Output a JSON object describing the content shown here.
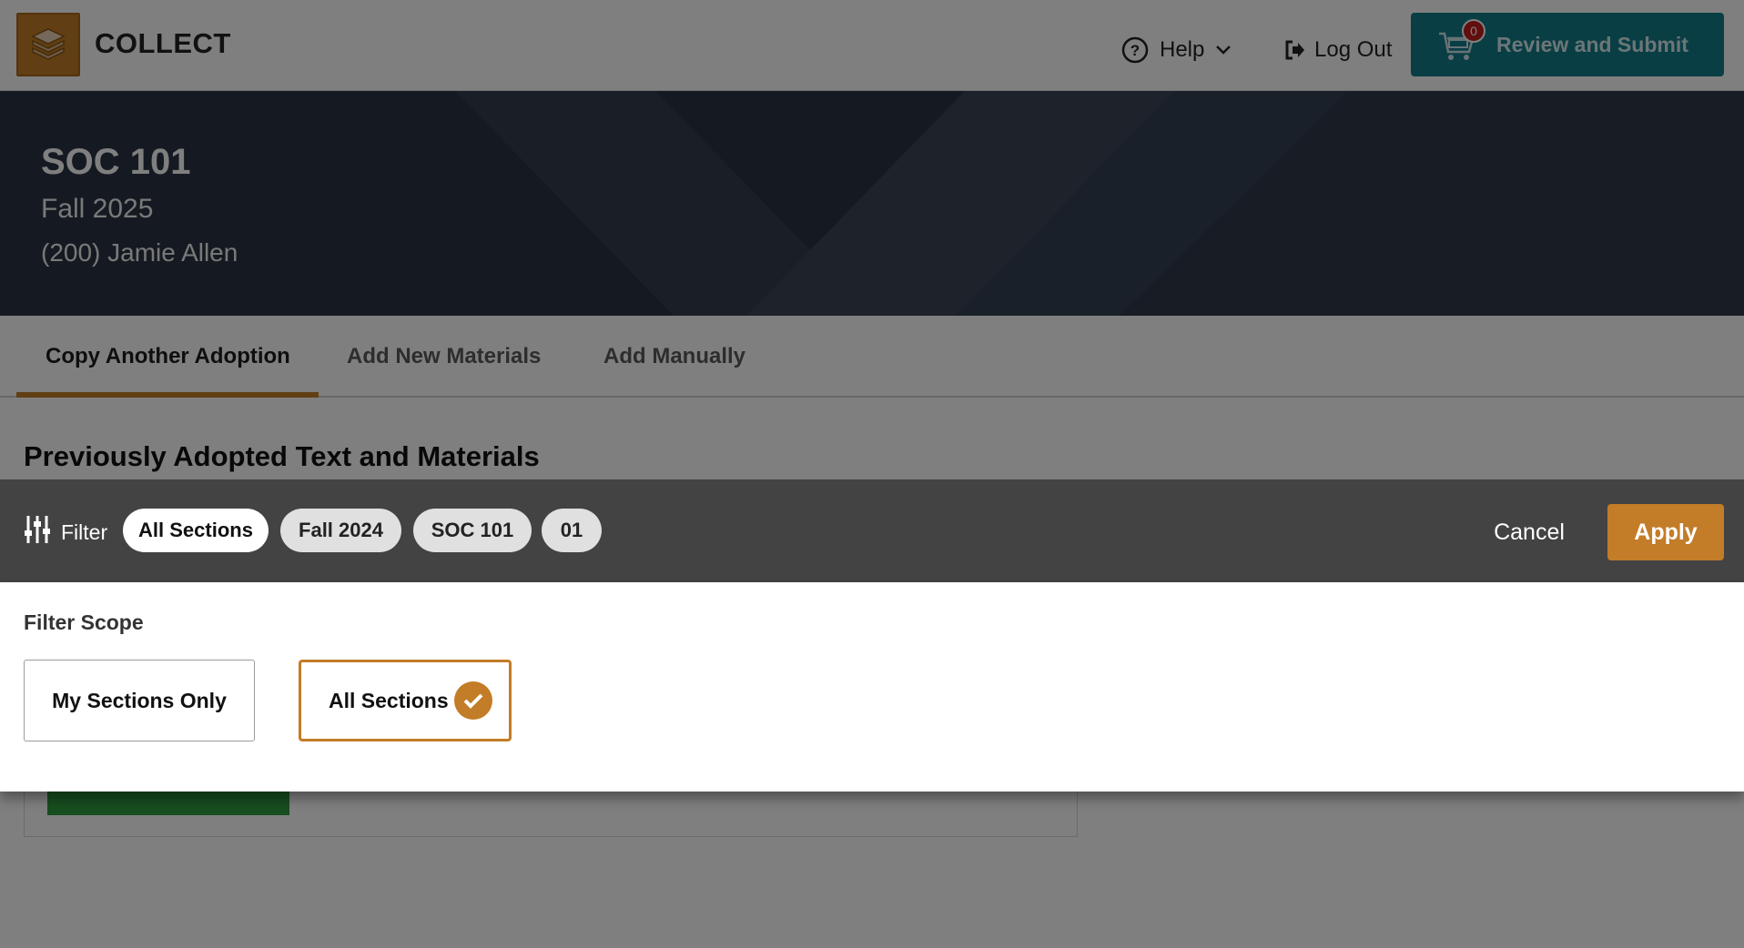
{
  "app": {
    "name": "COLLECT",
    "help_label": "Help",
    "logout_label": "Log Out",
    "review_label": "Review and Submit",
    "cart_count": "0"
  },
  "course": {
    "code": "SOC 101",
    "term": "Fall 2025",
    "instructor": "(200) Jamie Allen"
  },
  "tabs": [
    {
      "label": "Copy Another Adoption",
      "active": true
    },
    {
      "label": "Add New Materials",
      "active": false
    },
    {
      "label": "Add Manually",
      "active": false
    }
  ],
  "section_title": "Previously Adopted Text and Materials",
  "filter": {
    "label": "Filter",
    "chips": [
      {
        "label": "All Sections",
        "selected": true
      },
      {
        "label": "Fall 2024",
        "selected": false
      },
      {
        "label": "SOC 101",
        "selected": false
      },
      {
        "label": "01",
        "selected": false
      }
    ],
    "cancel_label": "Cancel",
    "apply_label": "Apply"
  },
  "scope": {
    "title": "Filter Scope",
    "options": [
      {
        "label": "My Sections Only",
        "selected": false
      },
      {
        "label": "All Sections",
        "selected": true
      }
    ]
  },
  "colors": {
    "accent": "#c37c27",
    "teal": "#127c8a",
    "hero": "#2a3445",
    "badge": "#c21d1d"
  }
}
